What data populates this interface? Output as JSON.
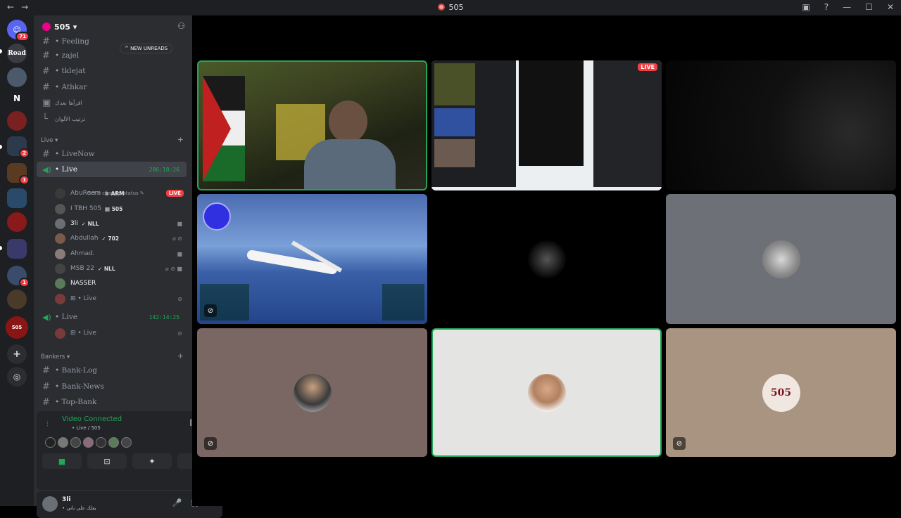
{
  "window": {
    "title": "505",
    "nav_back": "←",
    "nav_forward": "→",
    "controls": [
      "▣",
      "?",
      "—",
      "☐",
      "✕"
    ]
  },
  "server_rail": {
    "items": [
      {
        "label": "",
        "badge": "71",
        "color": "#5865f2"
      },
      {
        "label": "Road",
        "badge": "",
        "color": "#3a3c43"
      },
      {
        "label": "",
        "badge": "",
        "color": "#4a5a6a"
      },
      {
        "label": "N",
        "badge": "",
        "color": "#1e1f22"
      },
      {
        "label": "",
        "badge": "",
        "color": "#7a2020"
      },
      {
        "label": "",
        "badge": "2",
        "color": "#2b3b4b"
      },
      {
        "label": "",
        "badge": "1",
        "color": "#5a3a20"
      },
      {
        "label": "",
        "badge": "1",
        "color": "#2a4a6a"
      },
      {
        "label": "",
        "badge": "",
        "color": "#8a1a1a"
      },
      {
        "label": "",
        "badge": "",
        "color": "#3a3a6a"
      },
      {
        "label": "",
        "badge": "1",
        "color": "#3b4b6b"
      },
      {
        "label": "",
        "badge": "",
        "color": "#4a3a2a"
      },
      {
        "label": "505",
        "badge": "",
        "color": "#8a1515"
      }
    ],
    "add_icon": "+",
    "discover_icon": "◎"
  },
  "sidebar": {
    "server_name": "505 ▾",
    "new_unreads": "^ NEW UNREADS",
    "channels_top": [
      {
        "name": "• Feeling",
        "icon": "#"
      },
      {
        "name": "• zajel",
        "icon": "#"
      },
      {
        "name": "• tklejat",
        "icon": "#"
      },
      {
        "name": "• Athkar",
        "icon": "#"
      },
      {
        "name": "اقرأها بعدك",
        "icon": "▣"
      },
      {
        "name": "ترتيب الألوان",
        "icon": "└"
      }
    ],
    "live_category": "Live ▾",
    "channel_livenow": "• LiveNow",
    "channel_live": "• Live",
    "channel_live_timer": "286:18:26",
    "set_status": "Set a channel status ✎",
    "voice_users": [
      {
        "name": "AbuReem",
        "tag": "♛ ARM",
        "live": "LIVE",
        "icons": ""
      },
      {
        "name": "I TBH 505",
        "tag": "▦ 505",
        "live": "",
        "icons": ""
      },
      {
        "name": "3li",
        "tag": "✓ NLL",
        "live": "",
        "icons": "■"
      },
      {
        "name": "Abdullah",
        "tag": "✓ 702",
        "live": "",
        "icons": "⌀ ⊘"
      },
      {
        "name": "Ahmad.",
        "tag": "",
        "live": "",
        "icons": "■"
      },
      {
        "name": "MSB 22",
        "tag": "✓ NLL",
        "live": "",
        "icons": "⌀ ⊘ ■"
      },
      {
        "name": "NASSER",
        "tag": "",
        "live": "",
        "icons": ""
      },
      {
        "name": "⊞ • Live",
        "tag": "",
        "live": "",
        "icons": "⊘"
      }
    ],
    "channel_live2": "• Live",
    "channel_live2_timer": "142:14:25",
    "live2_user": "⊞ • Live",
    "bankers_category": "Bankers ▾",
    "bank_channels": [
      "• Bank-Log",
      "• Bank-News",
      "• Top-Bank"
    ],
    "voice_panel": {
      "title": "Video Connected",
      "subtitle": "• Live / 505",
      "signal_icon": "📶",
      "right_icons": [
        "⫼",
        "☎"
      ],
      "buttons": [
        "■",
        "⊡",
        "✦",
        "✋"
      ]
    },
    "user_panel": {
      "username": "3li",
      "status": "• بعلك على باني",
      "controls": [
        "🎤",
        "🎧",
        "⚙"
      ]
    }
  },
  "stage": {
    "tiles": [
      {
        "kind": "video-streamer",
        "live": ""
      },
      {
        "kind": "screen-share",
        "live": "LIVE"
      },
      {
        "kind": "dark-video",
        "live": ""
      },
      {
        "kind": "flight-sim",
        "live": ""
      },
      {
        "kind": "avatar-dark",
        "live": ""
      },
      {
        "kind": "avatar-grey",
        "live": ""
      },
      {
        "kind": "avatar-brown",
        "live": ""
      },
      {
        "kind": "avatar-light",
        "live": ""
      },
      {
        "kind": "avatar-tan",
        "live": ""
      }
    ],
    "avatar_label_505": "505",
    "mute_icon": "⊘"
  },
  "colors": {
    "accent_green": "#23a55a",
    "live_red": "#f23f43",
    "sidebar_bg": "#2b2d31"
  }
}
